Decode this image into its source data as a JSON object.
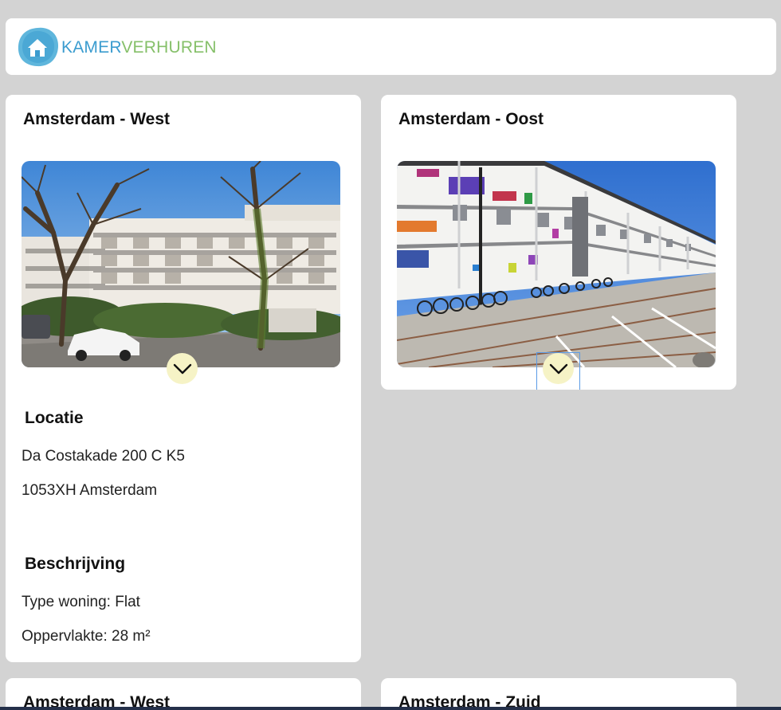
{
  "header": {
    "logo_part1": "KAMER",
    "logo_part2": "VERHUREN",
    "brand_blue": "#3b9ccf",
    "brand_green": "#86c06a"
  },
  "listings": [
    {
      "title": "Amsterdam - West",
      "photo_icon": "apartment-photo",
      "expand_icon": "chevron-down-icon",
      "location_heading": "Locatie",
      "address_line1": "Da Costakade 200 C K5",
      "address_line2": "1053XH Amsterdam",
      "description_heading": "Beschrijving",
      "type_line": "Type woning: Flat",
      "area_line": "Oppervlakte: 28 m²"
    },
    {
      "title": "Amsterdam - Oost",
      "photo_icon": "apartment-photo",
      "expand_icon": "chevron-down-icon"
    },
    {
      "title": "Amsterdam - West"
    },
    {
      "title": "Amsterdam - Zuid"
    }
  ],
  "colors": {
    "background": "#d3d3d3",
    "card": "#ffffff",
    "toggle_bg": "#f6f3c6"
  }
}
